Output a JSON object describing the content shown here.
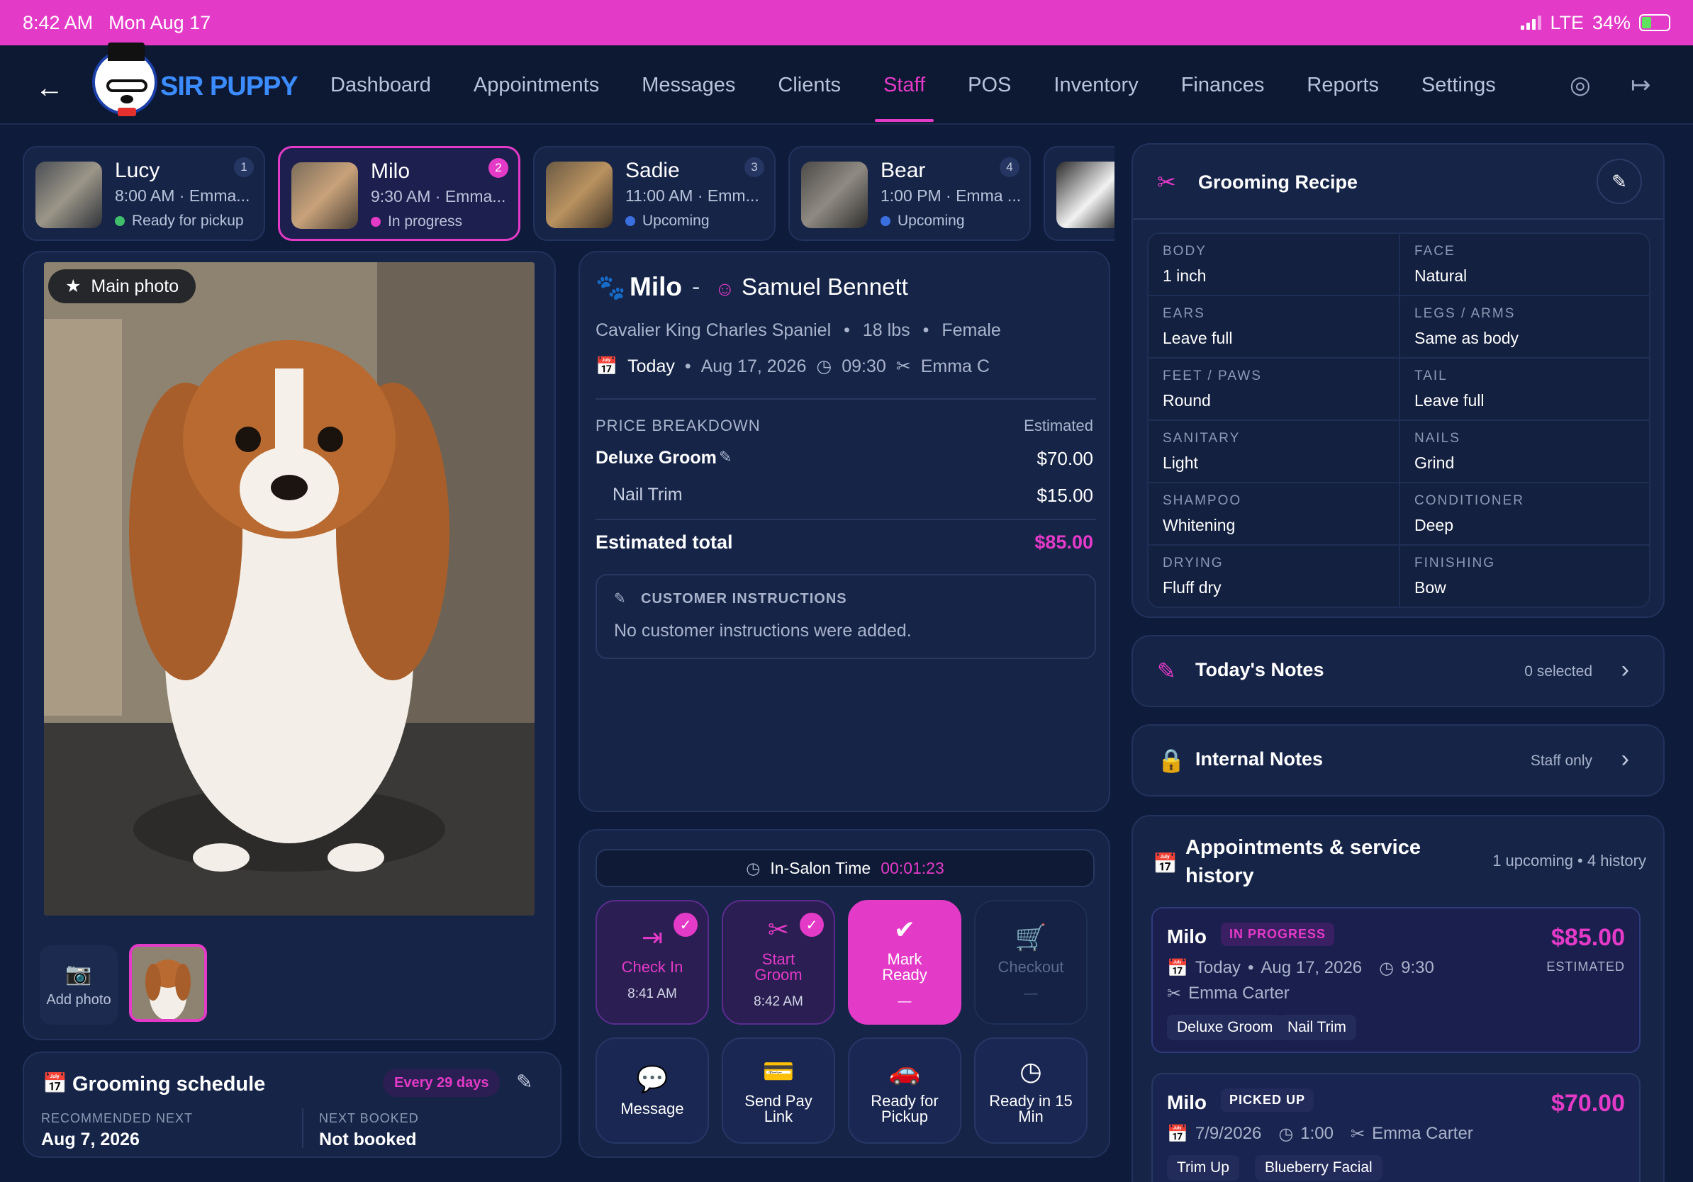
{
  "status_bar": {
    "time": "8:42 AM",
    "date": "Mon Aug 17",
    "network": "LTE",
    "battery": "34%"
  },
  "brand": {
    "name": "SIR PUPPY",
    "accent": "#e43ac8",
    "status_bg": "#e43ac8"
  },
  "nav": {
    "items": [
      "Dashboard",
      "Appointments",
      "Messages",
      "Clients",
      "Staff",
      "POS",
      "Inventory",
      "Finances",
      "Reports",
      "Settings"
    ],
    "active": "Staff",
    "icons": [
      "support-icon",
      "logout-icon"
    ]
  },
  "appointments": [
    {
      "name": "Lucy",
      "num": "1",
      "time": "8:00 AM · Emma...",
      "status": "Ready for pickup",
      "status_color": "#3fbf6c"
    },
    {
      "name": "Milo",
      "num": "2",
      "time": "9:30 AM · Emma...",
      "status": "In progress",
      "status_color": "#e43ac8"
    },
    {
      "name": "Sadie",
      "num": "3",
      "time": "11:00 AM · Emm...",
      "status": "Upcoming",
      "status_color": "#3b6fe0"
    },
    {
      "name": "Bear",
      "num": "4",
      "time": "1:00 PM · Emma ...",
      "status": "Upcoming",
      "status_color": "#3b6fe0"
    }
  ],
  "photo": {
    "main_label": "Main photo",
    "add_label": "Add photo"
  },
  "schedule": {
    "title": "Grooming schedule",
    "frequency": "Every 29 days",
    "rec_label": "RECOMMENDED NEXT",
    "rec_value": "Aug 7, 2026",
    "next_label": "NEXT BOOKED",
    "next_value": "Not booked"
  },
  "pet": {
    "name": "Milo",
    "sep": "-",
    "owner": "Samuel Bennett",
    "breed": "Cavalier King Charles Spaniel",
    "weight": "18 lbs",
    "sex": "Female",
    "day": "Today",
    "date": "Aug 17, 2026",
    "time": "09:30",
    "groomer": "Emma C"
  },
  "price": {
    "header": "PRICE BREAKDOWN",
    "estimated": "Estimated",
    "items": [
      {
        "name": "Deluxe Groom",
        "amount": "$70.00"
      },
      {
        "name": "Nail Trim",
        "amount": "$15.00"
      }
    ],
    "total_label": "Estimated total",
    "total": "$85.00"
  },
  "instructions": {
    "title": "CUSTOMER INSTRUCTIONS",
    "text": "No customer instructions were added."
  },
  "timer": {
    "label": "In-Salon Time",
    "value": "00:01:23"
  },
  "workflow": [
    {
      "label": "Check In",
      "sub": "8:41 AM"
    },
    {
      "label": "Start\nGroom",
      "sub": "8:42 AM"
    },
    {
      "label": "Mark\nReady",
      "sub": "—"
    },
    {
      "label": "Checkout",
      "sub": "—"
    }
  ],
  "quick_actions": [
    "Message",
    "Send Pay\nLink",
    "Ready for\nPickup",
    "Ready in 15\nMin"
  ],
  "recipe": {
    "title": "Grooming Recipe",
    "fields": [
      {
        "k": "BODY",
        "v": "1 inch"
      },
      {
        "k": "FACE",
        "v": "Natural"
      },
      {
        "k": "EARS",
        "v": "Leave full"
      },
      {
        "k": "LEGS / ARMS",
        "v": "Same as body"
      },
      {
        "k": "FEET / PAWS",
        "v": "Round"
      },
      {
        "k": "TAIL",
        "v": "Leave full"
      },
      {
        "k": "SANITARY",
        "v": "Light"
      },
      {
        "k": "NAILS",
        "v": "Grind"
      },
      {
        "k": "SHAMPOO",
        "v": "Whitening"
      },
      {
        "k": "CONDITIONER",
        "v": "Deep"
      },
      {
        "k": "DRYING",
        "v": "Fluff dry"
      },
      {
        "k": "FINISHING",
        "v": "Bow"
      }
    ]
  },
  "todays_notes": {
    "title": "Today's Notes",
    "meta": "0 selected"
  },
  "internal_notes": {
    "title": "Internal Notes",
    "meta": "Staff only"
  },
  "history": {
    "title": "Appointments & service history",
    "summary": "1 upcoming • 4 history",
    "items": [
      {
        "pet": "Milo",
        "badge": "IN PROGRESS",
        "day": "Today",
        "date": "Aug 17, 2026",
        "time": "9:30",
        "groomer": "Emma Carter",
        "amount": "$85.00",
        "amount_label": "ESTIMATED",
        "services": [
          "Deluxe Groom",
          "Nail Trim"
        ]
      },
      {
        "pet": "Milo",
        "badge": "PICKED UP",
        "date": "7/9/2026",
        "time": "1:00",
        "groomer": "Emma Carter",
        "amount": "$70.00",
        "services": [
          "Trim Up",
          "Blueberry Facial"
        ]
      }
    ]
  }
}
